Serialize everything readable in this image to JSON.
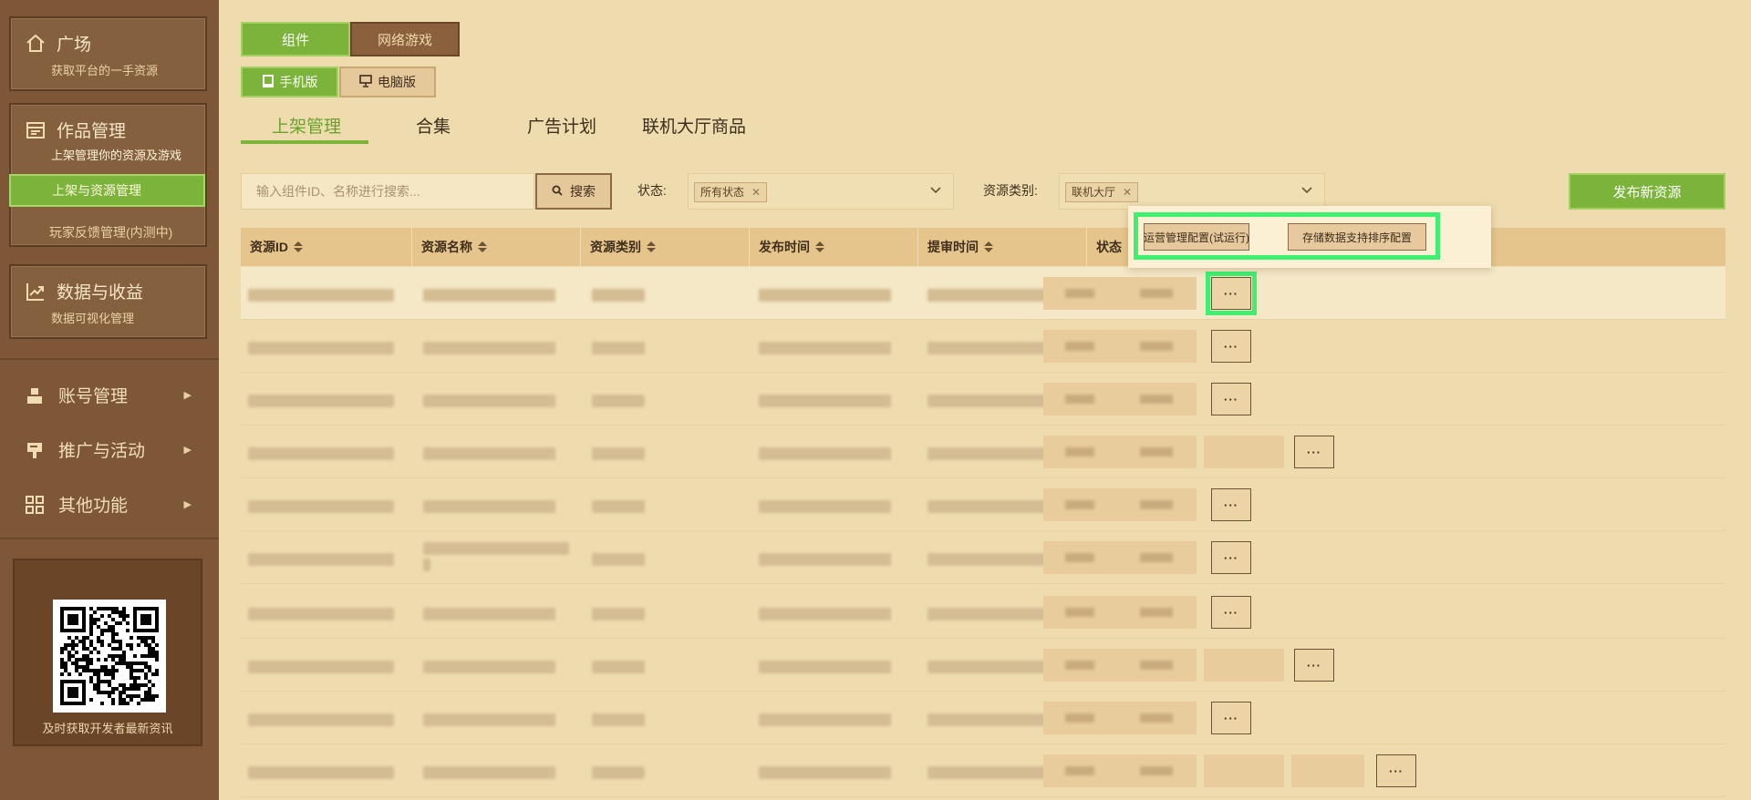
{
  "sidebar": {
    "cards": [
      {
        "title": "广场",
        "subtitle": "获取平台的一手资源",
        "icon": "home-icon"
      },
      {
        "title": "作品管理",
        "subtitle": "上架管理你的资源及游戏",
        "icon": "list-icon"
      },
      {
        "title": "数据与收益",
        "subtitle": "数据可视化管理",
        "icon": "chart-icon"
      }
    ],
    "works_items": [
      "上架与资源管理",
      "玩家反馈管理(内测中)"
    ],
    "menus": [
      {
        "label": "账号管理",
        "icon": "account-icon"
      },
      {
        "label": "推广与活动",
        "icon": "promotion-icon"
      },
      {
        "label": "其他功能",
        "icon": "grid-icon"
      }
    ],
    "qr_caption": "及时获取开发者最新资讯"
  },
  "top": {
    "type_tabs": [
      "组件",
      "网络游戏"
    ],
    "platform_tabs": [
      "手机版",
      "电脑版"
    ],
    "sub_tabs": [
      "上架管理",
      "合集",
      "广告计划",
      "联机大厅商品"
    ]
  },
  "filters": {
    "search_placeholder": "输入组件ID、名称进行搜索...",
    "search_button": "搜索",
    "status_label": "状态:",
    "status_chip": "所有状态",
    "category_label": "资源类别:",
    "category_chip": "联机大厅",
    "publish_button": "发布新资源"
  },
  "table": {
    "headers": [
      "资源ID",
      "资源名称",
      "资源类别",
      "发布时间",
      "提审时间",
      "状态"
    ],
    "more_label": "···"
  },
  "popover": {
    "buttons": [
      "运营管理配置(试运行)",
      "存储数据支持排序配置"
    ]
  },
  "colors": {
    "accent": "#7bb33b",
    "highlight": "#3ff070",
    "sidebar": "#7d5738",
    "page": "#efdcae"
  }
}
